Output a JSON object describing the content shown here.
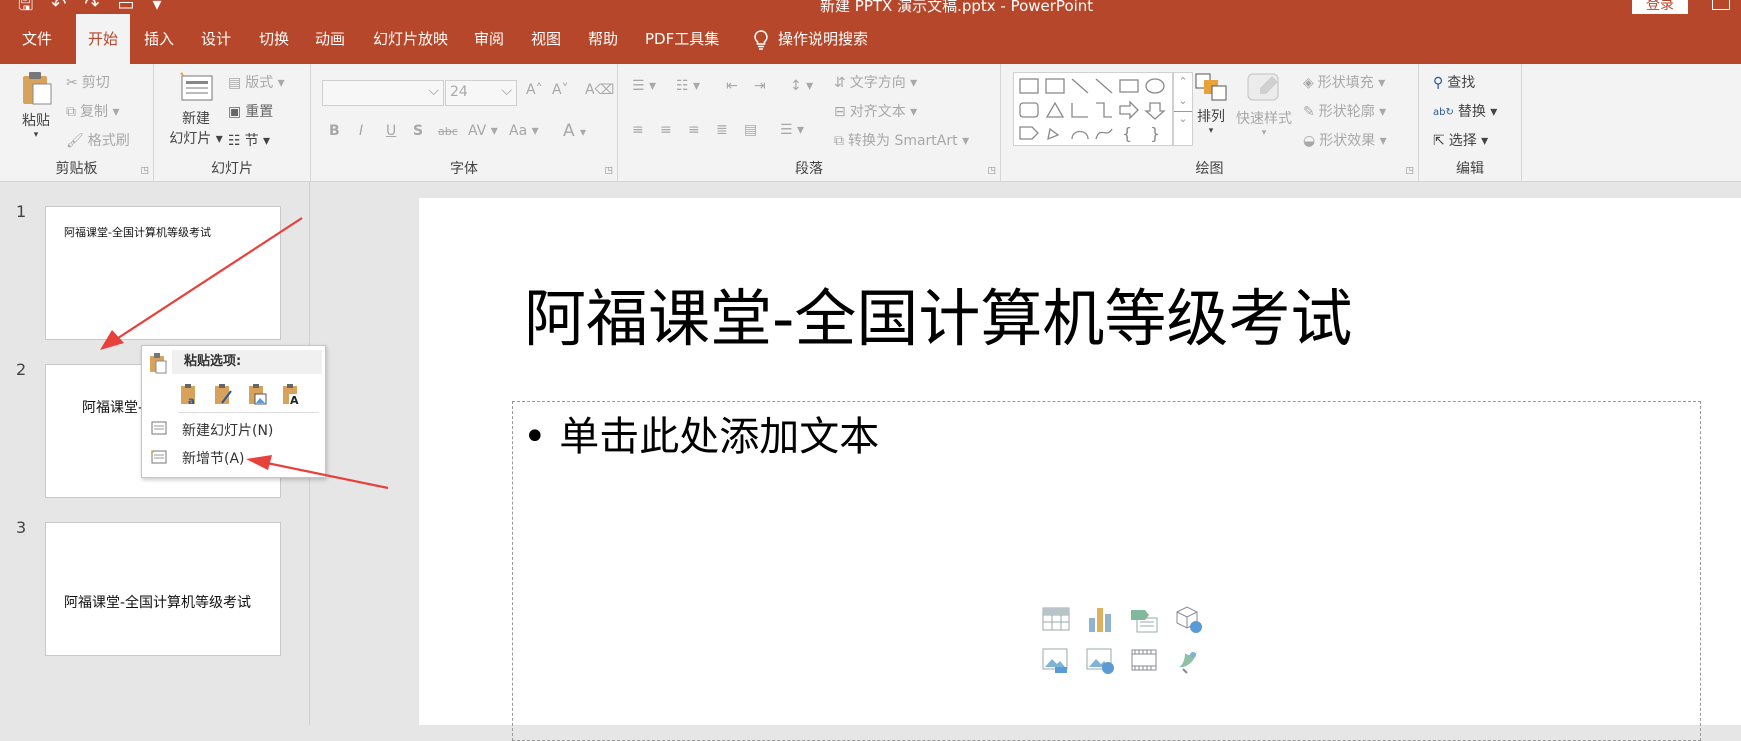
{
  "titlebar": {
    "title": "新建 PPTX 演示文稿.pptx - PowerPoint",
    "login": "登录",
    "qat_icons": [
      "save-icon",
      "undo-icon",
      "redo-icon",
      "slideshow-icon",
      "customize-icon"
    ]
  },
  "tabs": {
    "file": "文件",
    "home": "开始",
    "insert": "插入",
    "design": "设计",
    "transitions": "切换",
    "animations": "动画",
    "slideshow": "幻灯片放映",
    "review": "审阅",
    "view": "视图",
    "help": "帮助",
    "pdf": "PDF工具集",
    "search": "操作说明搜索"
  },
  "ribbon": {
    "clipboard": {
      "name": "剪贴板",
      "paste": "粘贴",
      "cut": "剪切",
      "copy": "复制",
      "painter": "格式刷"
    },
    "slides": {
      "name": "幻灯片",
      "new1": "新建",
      "new2": "幻灯片",
      "layout": "版式",
      "reset": "重置",
      "section": "节"
    },
    "font": {
      "name": "字体",
      "size": "24",
      "bold": "B",
      "italic": "I",
      "underline": "U",
      "shadow": "S",
      "strike": "abc",
      "spacing": "AV",
      "case": "Aa",
      "color": "A"
    },
    "paragraph": {
      "name": "段落",
      "direction": "文字方向",
      "align": "对齐文本",
      "smartart": "转换为 SmartArt"
    },
    "drawing": {
      "name": "绘图",
      "arrange": "排列",
      "quickstyle": "快速样式",
      "fill": "形状填充",
      "outline": "形状轮廓",
      "effects": "形状效果"
    },
    "editing": {
      "name": "编辑",
      "find": "查找",
      "replace": "替换",
      "select": "选择"
    }
  },
  "thumbs": [
    {
      "num": "1",
      "text": "阿福课堂-全国计算机等级考试"
    },
    {
      "num": "2",
      "text": "阿福课堂-"
    },
    {
      "num": "3",
      "text": "阿福课堂-全国计算机等级考试"
    }
  ],
  "context_menu": {
    "header": "粘贴选项:",
    "new_slide": "新建幻灯片(N)",
    "new_section": "新增节(A)"
  },
  "slide": {
    "title": "阿福课堂-全国计算机等级考试",
    "body": "• 单击此处添加文本"
  },
  "colors": {
    "accent": "#b7472a",
    "annotation": "#e8403a"
  }
}
